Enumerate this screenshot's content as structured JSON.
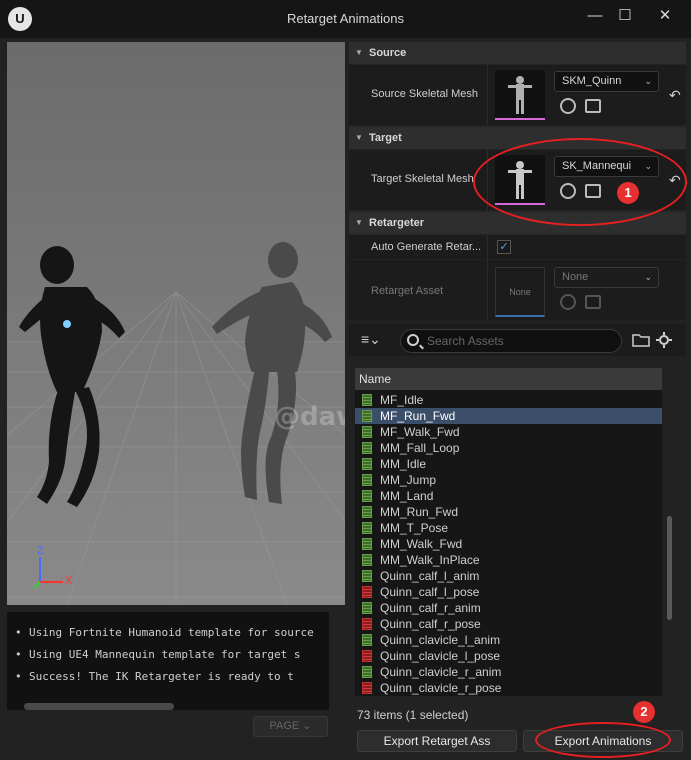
{
  "window": {
    "title": "Retarget Animations",
    "logo": "U",
    "minimize_glyph": "—",
    "maximize_glyph": "☐",
    "close_glyph": "✕"
  },
  "viewport": {
    "watermark": "@dawnarc",
    "axis_z": "Z",
    "axis_x": "X"
  },
  "log": {
    "lines": [
      "Using Fortnite Humanoid template for source",
      "Using UE4 Mannequin template for target s",
      "Success! The IK Retargeter is ready to t"
    ],
    "page_button": "PAGE"
  },
  "details": {
    "source": {
      "header": "Source",
      "label": "Source Skeletal Mesh",
      "value": "SKM_Quinn"
    },
    "target": {
      "header": "Target",
      "label": "Target Skeletal Mesh",
      "value": "SK_Mannequi"
    },
    "retargeter": {
      "header": "Retargeter",
      "auto_label": "Auto Generate Retar...",
      "auto_checked": true,
      "check_glyph": "✓",
      "asset_label": "Retarget Asset",
      "asset_value": "None",
      "asset_thumb_text": "None"
    },
    "reset_glyph": "↶",
    "caret_glyph": "⌄"
  },
  "annotations": {
    "badge_1": "1",
    "badge_2": "2",
    "color": "#e62020"
  },
  "asset_browser": {
    "filter_glyph": "≡⌄",
    "search_placeholder": "Search Assets",
    "column_header": "Name",
    "items": [
      {
        "name": "MF_Idle",
        "type": "anim"
      },
      {
        "name": "MF_Run_Fwd",
        "type": "anim"
      },
      {
        "name": "MF_Walk_Fwd",
        "type": "anim"
      },
      {
        "name": "MM_Fall_Loop",
        "type": "anim"
      },
      {
        "name": "MM_Idle",
        "type": "anim"
      },
      {
        "name": "MM_Jump",
        "type": "anim"
      },
      {
        "name": "MM_Land",
        "type": "anim"
      },
      {
        "name": "MM_Run_Fwd",
        "type": "anim"
      },
      {
        "name": "MM_T_Pose",
        "type": "anim"
      },
      {
        "name": "MM_Walk_Fwd",
        "type": "anim"
      },
      {
        "name": "MM_Walk_InPlace",
        "type": "anim"
      },
      {
        "name": "Quinn_calf_l_anim",
        "type": "anim"
      },
      {
        "name": "Quinn_calf_l_pose",
        "type": "pose"
      },
      {
        "name": "Quinn_calf_r_anim",
        "type": "anim"
      },
      {
        "name": "Quinn_calf_r_pose",
        "type": "pose"
      },
      {
        "name": "Quinn_clavicle_l_anim",
        "type": "anim"
      },
      {
        "name": "Quinn_clavicle_l_pose",
        "type": "pose"
      },
      {
        "name": "Quinn_clavicle_r_anim",
        "type": "anim"
      },
      {
        "name": "Quinn_clavicle_r_pose",
        "type": "pose"
      }
    ],
    "selected_item": "MF_Run_Fwd",
    "status": "73 items (1 selected)",
    "export_retarget_label": "Export Retarget Ass",
    "export_animations_label": "Export Animations"
  }
}
